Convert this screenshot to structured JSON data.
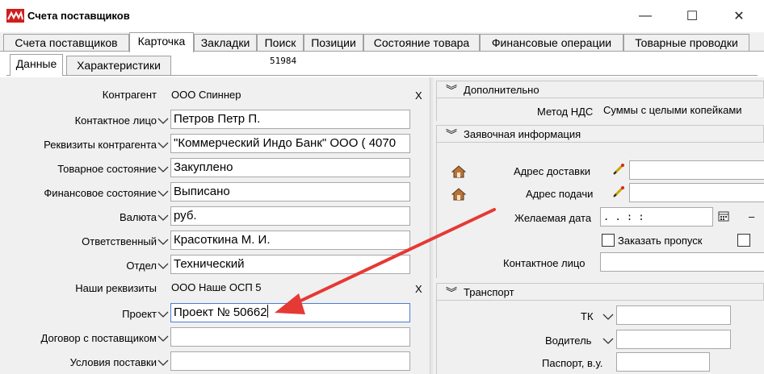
{
  "window": {
    "title": "Счета поставщиков",
    "minimize_glyph": "—",
    "maximize_glyph": "☐",
    "close_glyph": "✕"
  },
  "tabs": [
    {
      "label": "Счета поставщиков",
      "active": false
    },
    {
      "label": "Карточка",
      "active": true
    },
    {
      "label": "Закладки",
      "active": false
    },
    {
      "label": "Поиск",
      "active": false
    },
    {
      "label": "Позиции",
      "active": false
    },
    {
      "label": "Состояние товара",
      "active": false
    },
    {
      "label": "Финансовые операции",
      "active": false
    },
    {
      "label": "Товарные проводки",
      "active": false
    }
  ],
  "subtabs": [
    {
      "label": "Данные",
      "active": true
    },
    {
      "label": "Характеристики",
      "active": false
    }
  ],
  "record_id": "51984",
  "left_rows": [
    {
      "label": "Контрагент",
      "kind": "static",
      "value": "ООО Спиннер",
      "clear": "X"
    },
    {
      "label": "Контактное лицо",
      "kind": "field",
      "value": "Петров Петр П."
    },
    {
      "label": "Реквизиты контрагента",
      "kind": "field",
      "value": "\"Коммерческий Индо Банк\" ООО ( 4070"
    },
    {
      "label": "Товарное состояние",
      "kind": "field",
      "value": "Закуплено"
    },
    {
      "label": "Финансовое состояние",
      "kind": "field",
      "value": "Выписано"
    },
    {
      "label": "Валюта",
      "kind": "field",
      "value": "руб."
    },
    {
      "label": "Ответственный",
      "kind": "field",
      "value": "Красоткина М. И."
    },
    {
      "label": "Отдел",
      "kind": "field",
      "value": "Технический"
    },
    {
      "label": "Наши реквизиты",
      "kind": "static",
      "value": "ООО Наше ОСП 5",
      "clear": "X"
    },
    {
      "label": "Проект",
      "kind": "field",
      "value": "Проект № 50662",
      "focused": true
    },
    {
      "label": "Договор с поставщиком",
      "kind": "field",
      "value": ""
    },
    {
      "label": "Условия поставки",
      "kind": "field",
      "value": ""
    }
  ],
  "right": {
    "additional": {
      "title": "Дополнительно",
      "vat_label": "Метод НДС",
      "vat_value": "Суммы с целыми копейками"
    },
    "request": {
      "title": "Заявочная информация",
      "delivery_label": "Адрес доставки",
      "delivery_value": "",
      "pickup_label": "Адрес подачи",
      "pickup_value": "",
      "date_label": "Желаемая дата",
      "date_value": " .  .      :  :",
      "pass_label": "Заказать пропуск",
      "pass_checked": false,
      "contact_label": "Контактное лицо",
      "contact_value": ""
    },
    "transport": {
      "title": "Транспорт",
      "tk_label": "ТК",
      "tk_value": "",
      "driver_label": "Водитель",
      "driver_value": "",
      "passport_label": "Паспорт, в.у.",
      "passport_value": ""
    }
  },
  "colors": {
    "logo": "#d21d1d",
    "arrow": "#e53935",
    "field_border": "#a8a8a8",
    "focus_border": "#4a7fd4"
  }
}
